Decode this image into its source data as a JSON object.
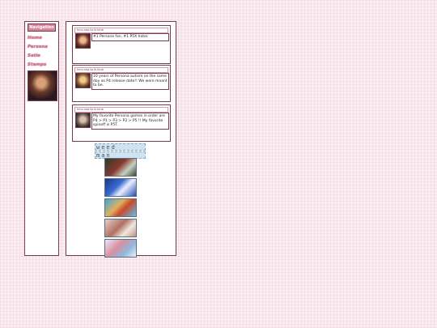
{
  "sidebar": {
    "title": "Navigation",
    "links": [
      "Home",
      "Persona",
      "Satie",
      "Stamps"
    ]
  },
  "posts": [
    {
      "header": "hmu.sep.tp.hi.blue",
      "text": "#1 Persona fan, #1 P5X hater."
    },
    {
      "header": "hmu.sep.tp.hi.blue",
      "text": "10 years of Persona autism on the same day as P4 release date!! We were meant to be."
    },
    {
      "header": "hmu.sep.tp.hi.blue",
      "text": "My favorite Persona games in order are P4 > P1 > P3 > P2 > P5 !! My favorite spinoff is P5T."
    }
  ],
  "stamp": {
    "line1": "weed",
    "line2": "man"
  },
  "colors": {
    "accent": "#d9849a",
    "link": "#e07090",
    "border": "#7a3b4e"
  }
}
